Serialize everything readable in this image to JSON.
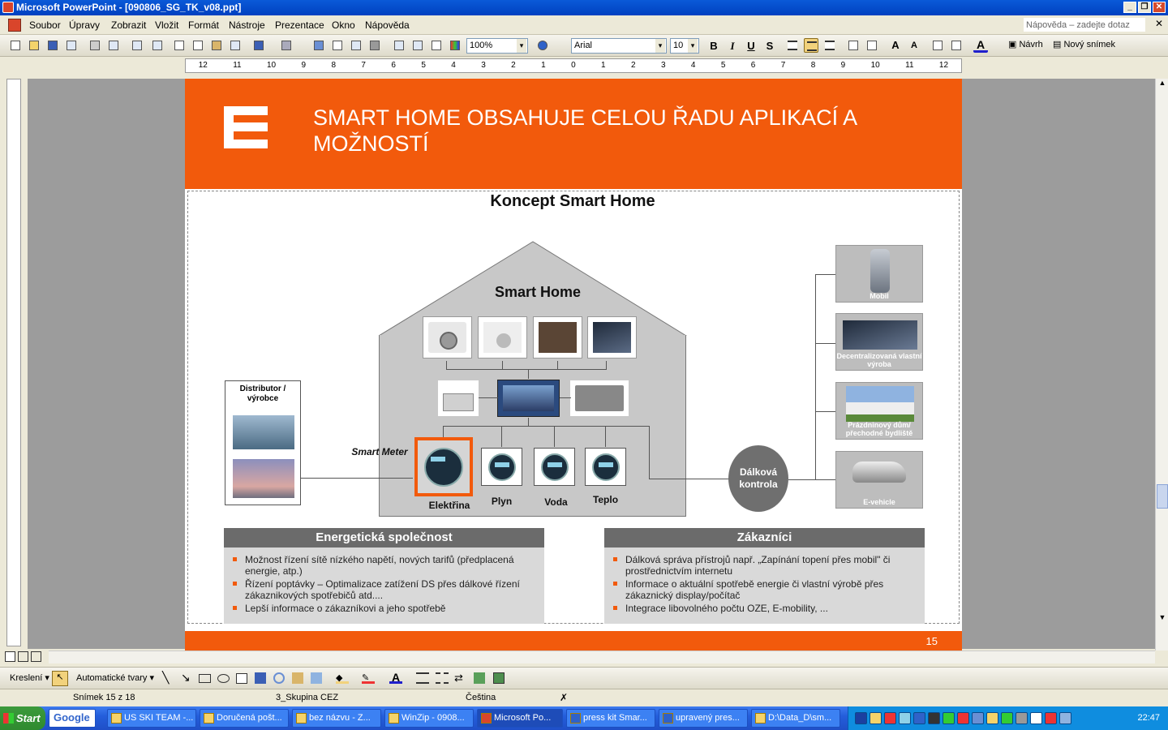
{
  "window": {
    "title": "Microsoft PowerPoint - [090806_SG_TK_v08.ppt]"
  },
  "menu": {
    "items": [
      "Soubor",
      "Úpravy",
      "Zobrazit",
      "Vložit",
      "Formát",
      "Nástroje",
      "Prezentace",
      "Okno",
      "Nápověda"
    ],
    "help_placeholder": "Nápověda – zadejte dotaz"
  },
  "toolbar": {
    "zoom": "100%",
    "font": "Arial",
    "font_size": "10",
    "bold": "B",
    "italic": "I",
    "underline": "U",
    "shadow": "S",
    "design_label": "Návrh",
    "new_slide_label": "Nový snímek"
  },
  "ruler": {
    "ticks": [
      "12",
      "11",
      "10",
      "9",
      "8",
      "7",
      "6",
      "5",
      "4",
      "3",
      "2",
      "1",
      "0",
      "1",
      "2",
      "3",
      "4",
      "5",
      "6",
      "7",
      "8",
      "9",
      "10",
      "11",
      "12"
    ]
  },
  "slide": {
    "title": "SMART HOME OBSAHUJE CELOU ŘADU APLIKACÍ A MOŽNOSTÍ",
    "concept_title": "Koncept Smart Home",
    "house_label": "Smart Home",
    "distributor_label": "Distributor / výrobce",
    "smart_meter_label": "Smart Meter",
    "meters": [
      "Elektřina",
      "Plyn",
      "Voda",
      "Teplo"
    ],
    "remote_control": "Dálková kontrola",
    "right_cards": [
      "Mobil",
      "Decentralizovaná vlastní výroba",
      "Prázdninový dům/ přechodné bydliště",
      "E-vehicle"
    ],
    "left_panel": {
      "title": "Energetická společnost",
      "bullets": [
        "Možnost řízení sítě nízkého  napětí, nových tarifů (předplacená energie, atp.)",
        "Řízení poptávky – Optimalizace zatížení DS přes dálkové řízení zákaznikových spotřebičů atd....",
        "Lepší informace o zákazníkovi a jeho spotřebě"
      ]
    },
    "right_panel": {
      "title": "Zákazníci",
      "bullets": [
        "Dálková správa přístrojů např. „Zapínání topení přes mobil\" či prostřednictvím internetu",
        "Informace o aktuální spotřebě energie či vlastní výrobě přes zákaznický display/počítač",
        "Integrace libovolného počtu OZE, E-mobility, ..."
      ]
    },
    "page_number": "15"
  },
  "drawing": {
    "draw_label": "Kreslení",
    "autoshapes_label": "Automatické tvary"
  },
  "status": {
    "slide_info": "Snímek 15 z 18",
    "design": "3_Skupina CEZ",
    "language": "Čeština"
  },
  "taskbar": {
    "start": "Start",
    "google": "Google",
    "items": [
      "US SKI TEAM -...",
      "Doručená pošt...",
      "bez názvu - Z...",
      "WinZip - 0908...",
      "Microsoft Po...",
      "press kit Smar...",
      "upravený pres...",
      "D:\\Data_D\\sm..."
    ],
    "clock": "22:47"
  },
  "colors": {
    "brand_orange": "#f25a0c",
    "panel_header": "#6b6b6b"
  }
}
